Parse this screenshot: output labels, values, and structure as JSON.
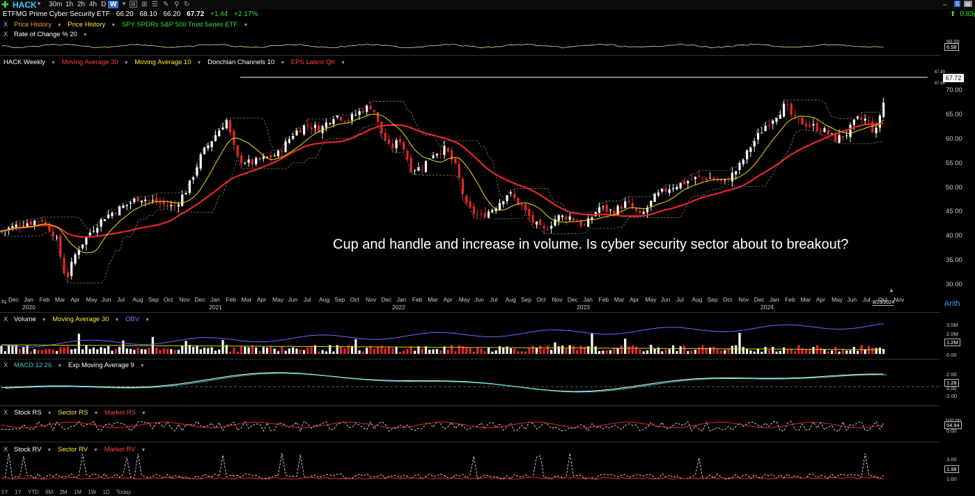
{
  "toolbar": {
    "ticker": "HACK",
    "intervals": [
      "30m",
      "1h",
      "2h",
      "4h",
      "D",
      "W"
    ],
    "active_interval": "W",
    "right_value": "0.83(1",
    "icons": [
      "add-icon",
      "layout-icon",
      "pencil-icon",
      "compare-icon",
      "refresh-icon"
    ]
  },
  "quote": {
    "name": "ETFMG Prime Cyber Security ETF",
    "open": "66.20",
    "high": "68.10",
    "low": "66.20",
    "last": "67.72",
    "change": "+1.44",
    "change_pct": "+2.17%"
  },
  "overlays_row": {
    "items": [
      "Price History",
      "Price History",
      "SPY SPDRs S&P 500 Trust Series ETF"
    ]
  },
  "roc_pane": {
    "title": "Rate of Change % 20",
    "labels": [
      "50.00",
      "6.58"
    ]
  },
  "price_pane": {
    "title": "HACK Weekly",
    "indicators": [
      "Moving Average 30",
      "Moving Average 10",
      "Donchian Channels 10",
      "EPS Latest Qtr"
    ],
    "y_ticks": [
      "70.00",
      "65.00",
      "60.00",
      "55.00",
      "50.00",
      "45.00",
      "40.00",
      "35.00",
      "30.00"
    ],
    "price_tag": "67.72",
    "small_tags": [
      "67.80",
      "67.68"
    ],
    "annotation": "Cup and handle and increase in volume. Is cyber security sector about to breakout?",
    "scale_mode": "Arith",
    "date_tag": "8/23/2024"
  },
  "x_axis": {
    "months": [
      "Dec",
      "Jan",
      "Feb",
      "Mar",
      "Apr",
      "May",
      "Jun",
      "Jul",
      "Aug",
      "Sep",
      "Oct",
      "Nov",
      "Dec",
      "Jan",
      "Feb",
      "Mar",
      "Apr",
      "May",
      "Jun",
      "Jul",
      "Aug",
      "Sep",
      "Oct",
      "Nov",
      "Dec",
      "Jan",
      "Feb",
      "Mar",
      "Apr",
      "May",
      "Jun",
      "Jul",
      "Aug",
      "Sep",
      "Oct",
      "Nov",
      "Dec",
      "Jan",
      "Feb",
      "Mar",
      "Apr",
      "May",
      "Jun",
      "Jul",
      "Aug",
      "Sep",
      "Oct",
      "Nov",
      "Dec",
      "Jan",
      "Feb",
      "Mar",
      "Apr",
      "May",
      "Jun",
      "Jul",
      "Oct",
      "Nov"
    ],
    "years": [
      "2020",
      "2021",
      "2022",
      "2023",
      "2024"
    ]
  },
  "volume_pane": {
    "title": "Volume",
    "indicators": [
      "Moving Average 30",
      "OBV"
    ],
    "labels": [
      "3.0M",
      "2.0M",
      "1.2M",
      "0.00"
    ]
  },
  "macd_pane": {
    "title": "MACD 12 26",
    "indicators": [
      "Exp Moving Average 9"
    ],
    "labels": [
      "2.00",
      "1.28",
      "0.00",
      "-2.00"
    ]
  },
  "rs_pane": {
    "title": "Stock RS",
    "indicators": [
      "Sector RS",
      "Market RS"
    ],
    "labels": [
      "100.00",
      "54.94",
      "0.00"
    ]
  },
  "rv_pane": {
    "title": "Stock RV",
    "indicators": [
      "Sector RV",
      "Market RV"
    ],
    "labels": [
      "3.00",
      "1.98",
      "1.00"
    ]
  },
  "bottom_ranges": [
    "5Y",
    "1Y",
    "YTD",
    "6M",
    "3M",
    "1M",
    "1W",
    "1D",
    "Today"
  ],
  "colors": {
    "up": "#ffffff",
    "down": "#e8262a",
    "ma30": "#e8262a",
    "ma10": "#f2e200",
    "donchian": "#777777",
    "obv": "#6a6aff",
    "macd_signal": "#22d3d3"
  }
}
